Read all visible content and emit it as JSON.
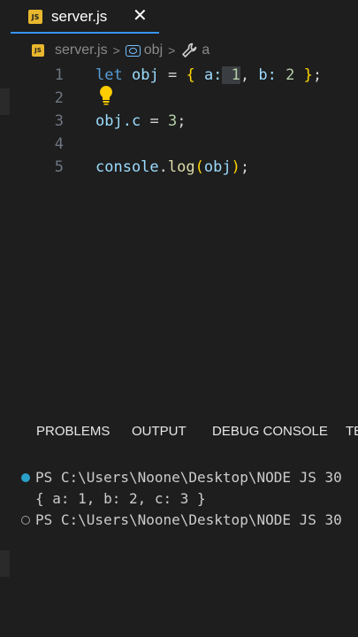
{
  "tab": {
    "title": "server.js",
    "badge": "JS",
    "close": "✕"
  },
  "breadcrumb": {
    "badge": "JS",
    "file": "server.js",
    "sep": ">",
    "symbol1": "obj",
    "symbol2": "a"
  },
  "editor": {
    "lines": [
      {
        "number": "1"
      },
      {
        "number": "2"
      },
      {
        "number": "3"
      },
      {
        "number": "4"
      },
      {
        "number": "5"
      }
    ],
    "code": {
      "l1_let": "let",
      "l1_obj": "obj",
      "l1_eq": "=",
      "l1_open": "{",
      "l1_a": "a:",
      "l1_one": "1",
      "l1_comma": ",",
      "l1_b": "b:",
      "l1_two": "2",
      "l1_close": "}",
      "l1_semi": ";",
      "l3_objc": "obj.c",
      "l3_eq": "=",
      "l3_three": "3",
      "l3_semi": ";",
      "l5_console": "console",
      "l5_dot": ".",
      "l5_log": "log",
      "l5_open": "(",
      "l5_arg": "obj",
      "l5_close": ")",
      "l5_semi": ";"
    }
  },
  "panel": {
    "tabs": [
      "PROBLEMS",
      "OUTPUT",
      "DEBUG CONSOLE",
      "TE"
    ]
  },
  "terminal": {
    "lines": [
      "PS C:\\Users\\Noone\\Desktop\\NODE JS 30",
      "{ a: 1, b: 2, c: 3 }",
      "PS C:\\Users\\Noone\\Desktop\\NODE JS 30"
    ]
  },
  "colors": {
    "accent": "#3794ff",
    "js_badge": "#e8b72e",
    "bulb": "#ffcc00",
    "terminal_dot": "#2aa1c9"
  }
}
